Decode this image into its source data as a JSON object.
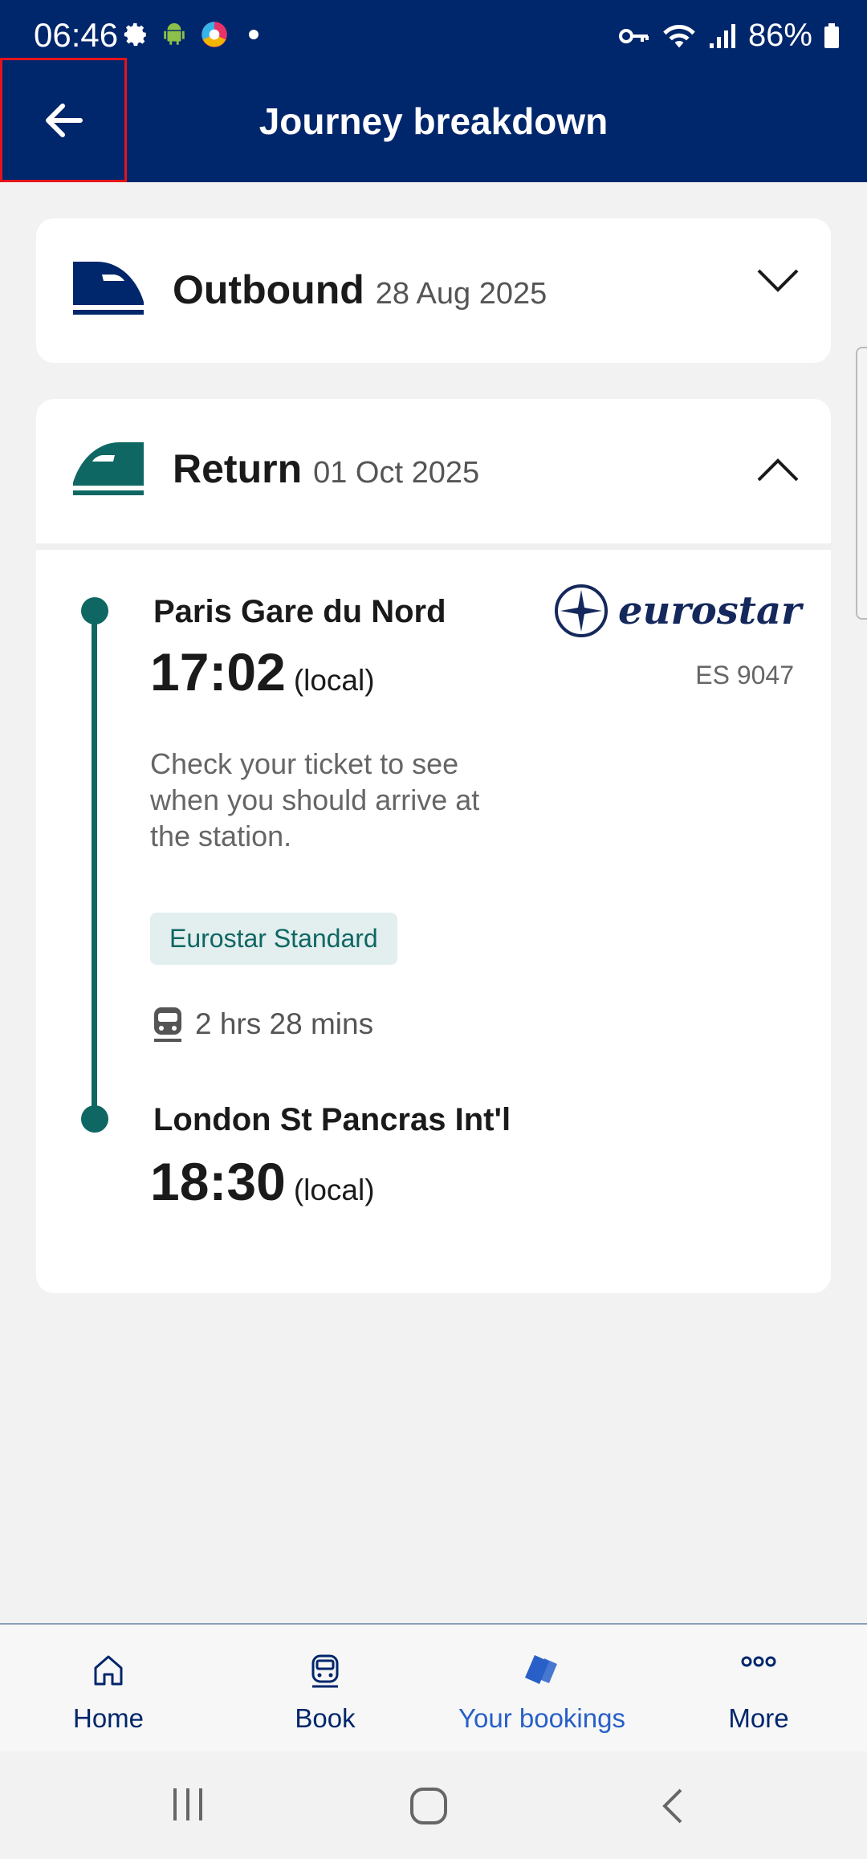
{
  "status_bar": {
    "time": "06:46",
    "battery": "86%"
  },
  "app_bar": {
    "title": "Journey breakdown"
  },
  "outbound": {
    "label": "Outbound",
    "date": "28 Aug 2025"
  },
  "return": {
    "label": "Return",
    "date": "01 Oct 2025",
    "departure_station": "Paris Gare du Nord",
    "departure_time": "17:02",
    "departure_suffix": "(local)",
    "operator": "eurostar",
    "train_number": "ES 9047",
    "note": "Check your ticket to see when you should arrive at the station.",
    "fare_class": "Eurostar Standard",
    "duration": "2 hrs 28 mins",
    "arrival_station": "London St Pancras Int'l",
    "arrival_time": "18:30",
    "arrival_suffix": "(local)"
  },
  "bottom_nav": {
    "items": [
      {
        "label": "Home",
        "icon": "home-icon"
      },
      {
        "label": "Book",
        "icon": "train-icon"
      },
      {
        "label": "Your bookings",
        "icon": "ticket-icon"
      },
      {
        "label": "More",
        "icon": "more-icon"
      }
    ],
    "active_index": 2
  },
  "colors": {
    "brand_navy": "#00266b",
    "teal": "#0e6763",
    "highlight_red": "#e4141b"
  }
}
